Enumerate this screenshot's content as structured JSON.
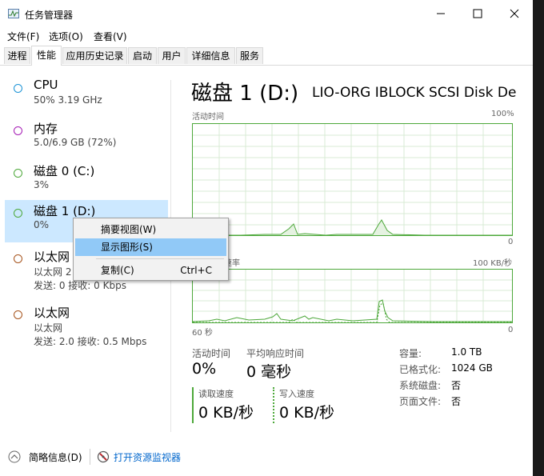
{
  "window": {
    "title": "任务管理器"
  },
  "menu": [
    "文件(F)",
    "选项(O)",
    "查看(V)"
  ],
  "tabs": [
    "进程",
    "性能",
    "应用历史记录",
    "启动",
    "用户",
    "详细信息",
    "服务"
  ],
  "devices": [
    {
      "name": "CPU",
      "sub": "50% 3.19 GHz",
      "sub2": "",
      "color": "#1c93d6"
    },
    {
      "name": "内存",
      "sub": "5.0/6.9 GB (72%)",
      "sub2": "",
      "color": "#a51cb5"
    },
    {
      "name": "磁盘 0 (C:)",
      "sub": "3%",
      "sub2": "",
      "color": "#4da83a"
    },
    {
      "name": "磁盘 1 (D:)",
      "sub": "0%",
      "sub2": "",
      "color": "#4da83a"
    },
    {
      "name": "以太网",
      "sub": "以太网 2",
      "sub2": "发送: 0 接收: 0 Kbps",
      "color": "#a6531c"
    },
    {
      "name": "以太网",
      "sub": "以太网",
      "sub2": "发送: 2.0 接收: 0.5 Mbps",
      "color": "#a6531c"
    }
  ],
  "main": {
    "title": "磁盘 1 (D:)",
    "model": "LIO-ORG IBLOCK SCSI Disk Dev...",
    "graph1": {
      "label": "活动时间",
      "max": "100%",
      "min": "0"
    },
    "graph2": {
      "label": "磁盘传输速率",
      "max": "100 KB/秒",
      "time": "60 秒",
      "min": "0"
    },
    "stats": {
      "active_label": "活动时间",
      "active_value": "0%",
      "resp_label": "平均响应时间",
      "resp_value": "0 毫秒",
      "read_label": "读取速度",
      "read_value": "0 KB/秒",
      "write_label": "写入速度",
      "write_value": "0 KB/秒"
    },
    "props": [
      {
        "k": "容量:",
        "v": "1.0 TB"
      },
      {
        "k": "已格式化:",
        "v": "1024 GB"
      },
      {
        "k": "系统磁盘:",
        "v": "否"
      },
      {
        "k": "页面文件:",
        "v": "否"
      }
    ]
  },
  "context_menu": {
    "items": [
      {
        "label": "摘要视图(W)",
        "shortcut": ""
      },
      {
        "label": "显示图形(S)",
        "shortcut": ""
      },
      {
        "label": "复制(C)",
        "shortcut": "Ctrl+C"
      }
    ]
  },
  "footer": {
    "brief": "简略信息(D)",
    "monitor": "打开资源监视器"
  },
  "chart_data": [
    {
      "type": "area",
      "title": "活动时间",
      "ylim": [
        0,
        100
      ],
      "x": [
        0,
        60
      ],
      "values": "mostly 0 with small spikes around 20-35%"
    }
  ]
}
